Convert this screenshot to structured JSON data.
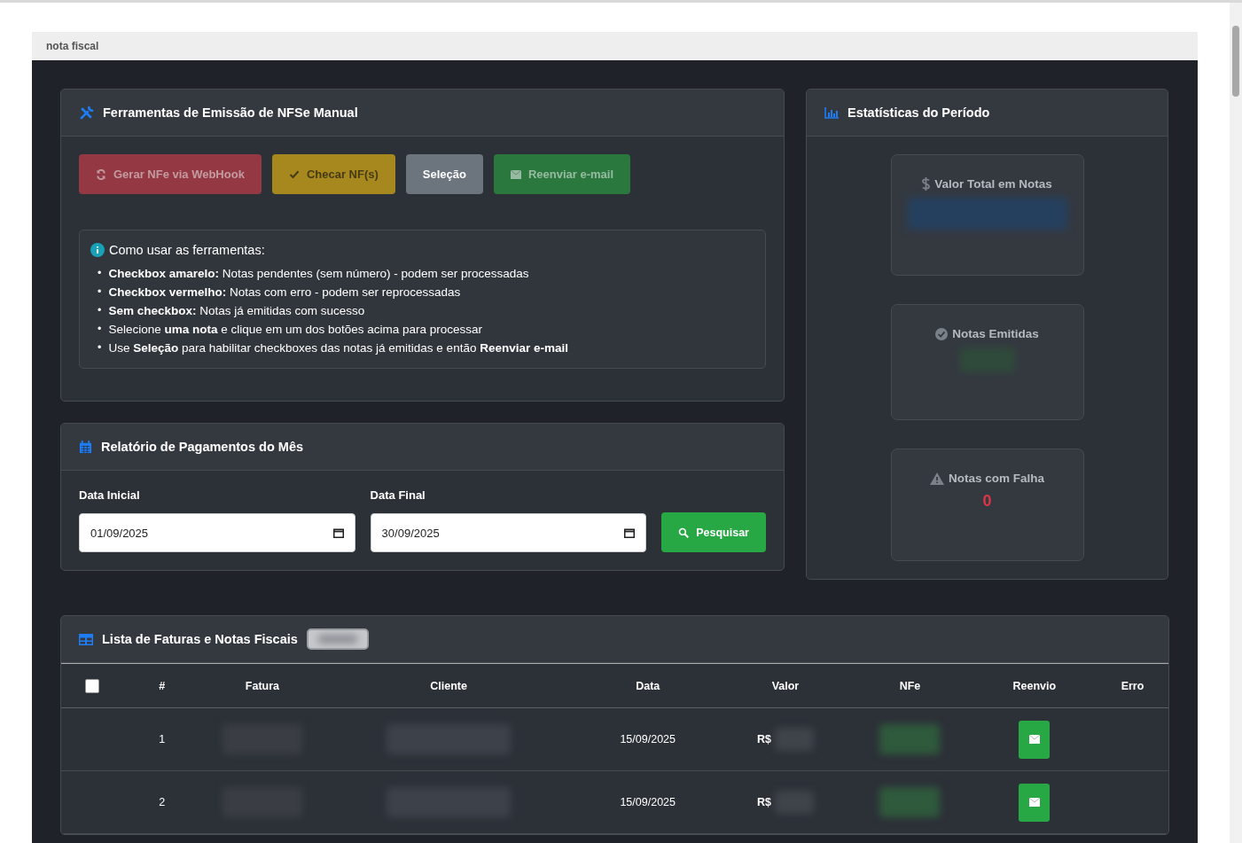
{
  "tab": {
    "title": "nota fiscal"
  },
  "tools": {
    "title": "Ferramentas de Emissão de NFSe Manual",
    "buttons": [
      {
        "kind": "danger",
        "label": "Gerar NFe via WebHook",
        "disabled": true
      },
      {
        "kind": "warning",
        "label": "Checar NF(s)",
        "disabled": true
      },
      {
        "kind": "secondary",
        "label": "Seleção",
        "disabled": false
      },
      {
        "kind": "success",
        "label": "Reenviar e-mail",
        "disabled": true
      }
    ],
    "help": {
      "title": "Como usar as ferramentas:",
      "bullet": "•",
      "items": [
        "**Checkbox amarelo:** Notas pendentes (sem número) - podem ser processadas",
        "**Checkbox vermelho:** Notas com erro - podem ser reprocessadas",
        "**Sem checkbox:** Notas já emitidas com sucesso",
        "Selecione **uma nota** e clique em um dos botões acima para processar",
        "Use **Seleção** para habilitar checkboxes das notas já emitidas e então **Reenviar e-mail**"
      ]
    }
  },
  "report": {
    "title": "Relatório de Pagamentos do Mês",
    "start_label": "Data Inicial",
    "start_value": "01/09/2025",
    "end_label": "Data Final",
    "end_value": "30/09/2025",
    "search_button": "Pesquisar"
  },
  "stats": {
    "title": "Estatísticas do Período",
    "cards": [
      {
        "kind": "money",
        "label": "Valor Total em Notas"
      },
      {
        "kind": "issued",
        "label": "Notas Emitidas"
      },
      {
        "kind": "failed",
        "label": "Notas com Falha",
        "value": "0"
      }
    ]
  },
  "table": {
    "title": "Lista de Faturas e Notas Fiscais",
    "select_all_checked": false,
    "columns": [
      "#",
      "Fatura",
      "Cliente",
      "Data",
      "Valor",
      "NFe",
      "Reenvio",
      "Erro"
    ],
    "rows": [
      {
        "index": "1",
        "date": "15/09/2025",
        "currency": "R$"
      },
      {
        "index": "2",
        "date": "15/09/2025",
        "currency": "R$"
      }
    ]
  }
}
